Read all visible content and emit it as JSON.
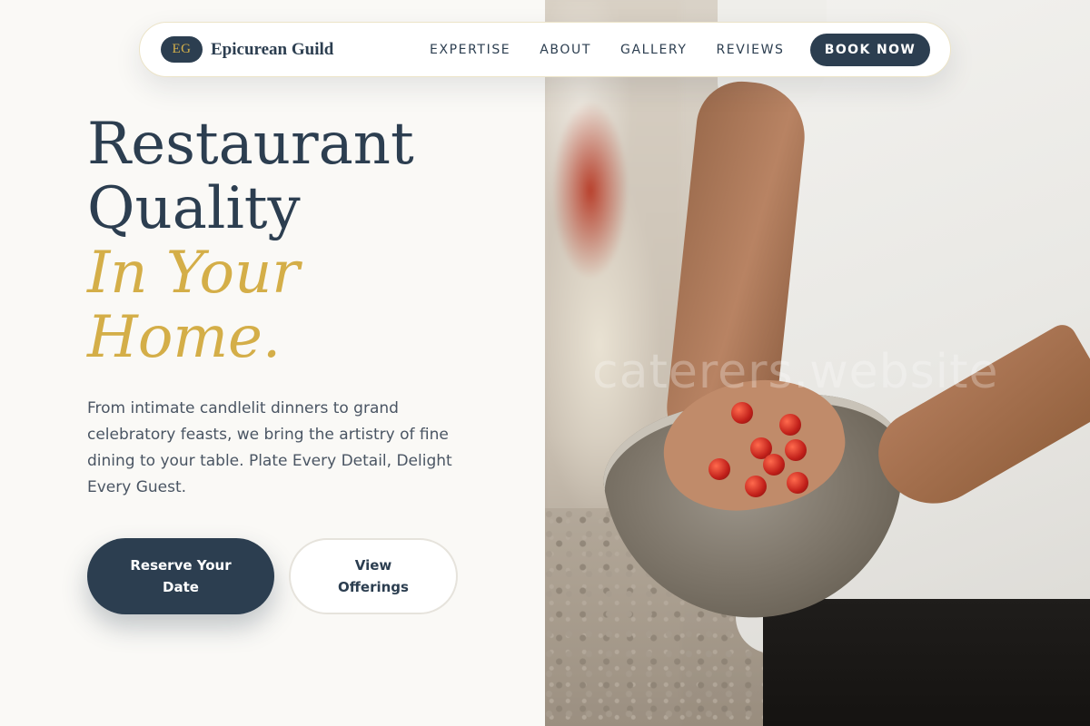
{
  "brand": {
    "badge": "EG",
    "name": "Epicurean Guild"
  },
  "nav": {
    "links": [
      {
        "label": "EXPERTISE"
      },
      {
        "label": "ABOUT"
      },
      {
        "label": "GALLERY"
      },
      {
        "label": "REVIEWS"
      }
    ],
    "cta_label": "BOOK NOW"
  },
  "hero": {
    "title_line1": "Restaurant",
    "title_line2": "Quality",
    "title_accent_line1": "In Your",
    "title_accent_line2": "Home.",
    "description": "From intimate candlelit dinners to grand celebratory feasts, we bring the artistry of fine dining to your table. Plate Every Detail, Delight Every Guest.",
    "primary_button": "Reserve Your Date",
    "secondary_button": "View Offerings"
  },
  "photo": {
    "watermark": "caterers.website"
  },
  "colors": {
    "navy": "#2c3e50",
    "gold": "#d4ae48",
    "background": "#faf9f6"
  }
}
